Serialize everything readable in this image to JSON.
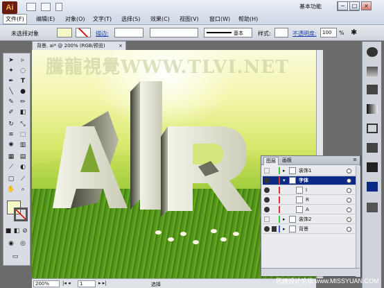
{
  "app": {
    "logo": "Ai",
    "workspace": "基本功能"
  },
  "menu": [
    "文件(F)",
    "编辑(E)",
    "对象(O)",
    "文字(T)",
    "选择(S)",
    "效果(C)",
    "视图(V)",
    "窗口(W)",
    "帮助(H)"
  ],
  "window_buttons": [
    "−",
    "□",
    "×"
  ],
  "control_bar": {
    "selection": "未选择对象",
    "stroke_label": "描边:",
    "brush": "基本",
    "style_label": "样式:",
    "opacity_label": "不透明度:",
    "opacity_value": "100",
    "opacity_unit": "%"
  },
  "document": {
    "tab_title": "背景. ai* @ 200% (RGB/预览)",
    "watermark": "騰龍視覺WWW.TLVI.NET",
    "zoom": "200%",
    "page": "1",
    "status": "选择"
  },
  "layers_panel": {
    "tabs": [
      "图层",
      "画板"
    ],
    "rows": [
      {
        "name": "装饰1",
        "level": 0,
        "visible": false,
        "locked": false,
        "selected": false,
        "color": "#3ac43a"
      },
      {
        "name": "字体",
        "level": 0,
        "visible": true,
        "locked": false,
        "selected": true,
        "color": "#d33"
      },
      {
        "name": "I",
        "level": 1,
        "visible": true,
        "locked": false,
        "selected": false,
        "color": "#d33"
      },
      {
        "name": "R",
        "level": 1,
        "visible": true,
        "locked": false,
        "selected": false,
        "color": "#d33"
      },
      {
        "name": "A",
        "level": 1,
        "visible": true,
        "locked": false,
        "selected": false,
        "color": "#d33"
      },
      {
        "name": "装饰2",
        "level": 0,
        "visible": false,
        "locked": false,
        "selected": false,
        "color": "#3ac43a"
      },
      {
        "name": "背景",
        "level": 0,
        "visible": true,
        "locked": true,
        "selected": false,
        "color": "#3a5fd3"
      }
    ]
  },
  "credit": "思缘设计论坛 www.MISSYUAN.COM"
}
